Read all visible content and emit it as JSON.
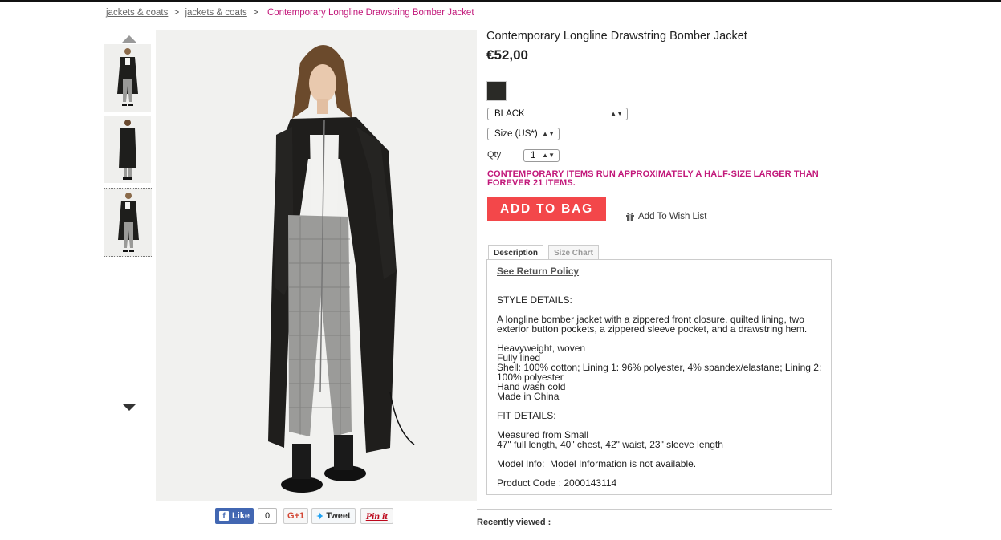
{
  "breadcrumb": {
    "crumb1": "jackets & coats",
    "sep1": ">",
    "crumb2": "jackets & coats",
    "sep2": ">",
    "current": "Contemporary Longline Drawstring Bomber Jacket"
  },
  "product": {
    "title": "Contemporary Longline Drawstring Bomber Jacket",
    "price": "€52,00",
    "swatch_color": "#2a2a26",
    "color_select": "BLACK",
    "size_select": "Size (US*)",
    "qty_label": "Qty",
    "qty_value": "1",
    "notice": "CONTEMPORARY ITEMS RUN APPROXIMATELY A HALF-SIZE LARGER THAN FOREVER 21 ITEMS.",
    "add_to_bag": "ADD TO BAG",
    "wishlist": "Add To Wish List",
    "wishlist_icon": "gift-icon"
  },
  "tabs": {
    "description": "Description",
    "size_chart": "Size Chart"
  },
  "description": {
    "return_policy": "See Return Policy",
    "style_heading": "STYLE DETAILS:",
    "style_text": "A longline bomber jacket with a zippered front closure, quilted lining, two exterior button pockets, a zippered sleeve pocket, and a drawstring hem.",
    "details": [
      "Heavyweight, woven",
      "Fully lined",
      "Shell: 100% cotton; Lining 1: 96% polyester, 4% spandex/elastane; Lining 2: 100% polyester",
      "Hand wash cold",
      "Made in China"
    ],
    "fit_heading": "FIT DETAILS:",
    "fit_lines": [
      "Measured from Small",
      "47\" full length, 40\" chest, 42\" waist, 23\" sleeve length"
    ],
    "model_info": "Model Info:  Model Information is not available.",
    "product_code": "Product Code : 2000143114"
  },
  "social": {
    "like": "Like",
    "like_count": "0",
    "gplus": "G+1",
    "tweet": "Tweet",
    "pin": "Pin it"
  },
  "recently_viewed": "Recently viewed :",
  "colors": {
    "accent_pink": "#c2187a",
    "add_to_bag_red": "#f3474a",
    "facebook_blue": "#4267b2"
  }
}
